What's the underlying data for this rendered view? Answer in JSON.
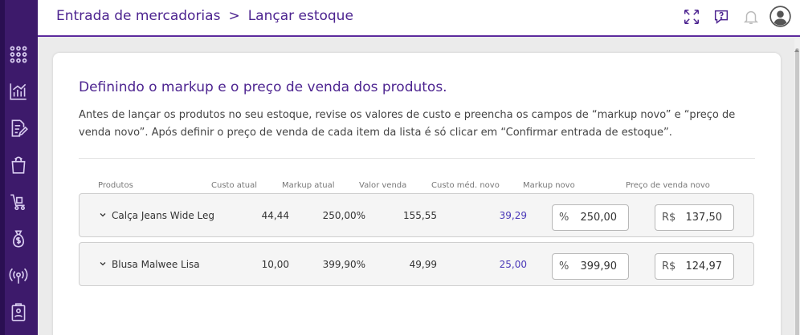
{
  "breadcrumb": {
    "parent": "Entrada de mercadorias",
    "separator": ">",
    "current": "Lançar estoque"
  },
  "sidebar": {
    "icons": [
      "apps-grid-icon",
      "chart-icon",
      "edit-document-icon",
      "shopping-bag-icon",
      "cart-icon",
      "money-bag-icon",
      "broadcast-icon",
      "clipboard-icon"
    ]
  },
  "header": {
    "icons": [
      "fullscreen-icon",
      "help-icon",
      "bell-icon",
      "user-avatar-icon"
    ]
  },
  "content": {
    "title": "Definindo o markup e o preço de venda dos produtos.",
    "description": "Antes de lançar os produtos no seu estoque, revise os valores de custo e preencha os campos de “markup novo” e “preço de venda novo”. Após definir o preço de venda de cada item da lista é só clicar em “Confirmar entrada de estoque”."
  },
  "table": {
    "columns": {
      "produtos": "Produtos",
      "custo_atual": "Custo atual",
      "markup_atual": "Markup atual",
      "valor_venda": "Valor venda",
      "custo_med_novo": "Custo méd. novo",
      "markup_novo": "Markup novo",
      "preco_venda_novo": "Preço de venda novo"
    },
    "rows": [
      {
        "produto": "Calça Jeans Wide Leg",
        "custo_atual": "44,44",
        "markup_atual": "250,00%",
        "valor_venda": "155,55",
        "custo_med_novo": "39,29",
        "markup_prefix": "%",
        "markup_novo": "250,00",
        "preco_prefix": "R$",
        "preco_venda_novo": "137,50"
      },
      {
        "produto": "Blusa Malwee Lisa",
        "custo_atual": "10,00",
        "markup_atual": "399,90%",
        "valor_venda": "49,99",
        "custo_med_novo": "25,00",
        "markup_prefix": "%",
        "markup_novo": "399,90",
        "preco_prefix": "R$",
        "preco_venda_novo": "124,97"
      }
    ]
  },
  "colors": {
    "primary": "#4d2490",
    "sidebar": "#3d1a6b",
    "accent_value": "#4a38b8"
  }
}
